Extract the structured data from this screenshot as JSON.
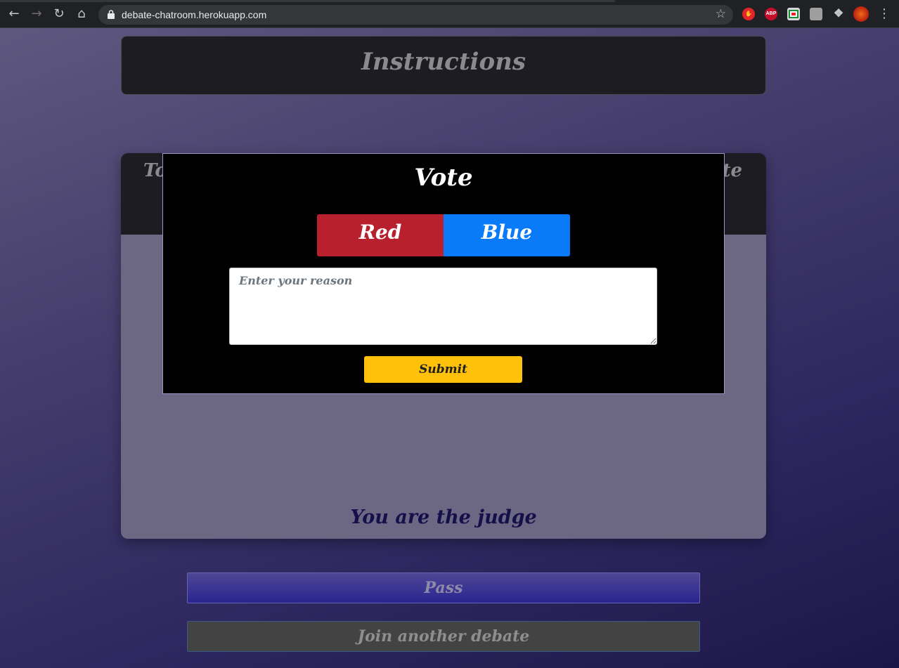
{
  "browser": {
    "url": "debate-chatroom.herokuapp.com",
    "extensions": [
      {
        "name": "hand-stop-extension-icon",
        "label": "",
        "color": "#e3242b"
      },
      {
        "name": "adblock-plus-icon",
        "label": "ABP",
        "color": "#c70d2c"
      },
      {
        "name": "pocket-extension-icon",
        "label": "",
        "color": "#d8d8d8"
      },
      {
        "name": "grey-extension-icon",
        "label": "",
        "color": "#9e9e9e"
      },
      {
        "name": "puzzle-extensions-icon",
        "label": "",
        "color": "#c4c7c5"
      },
      {
        "name": "profile-avatar-icon",
        "label": "",
        "color": "#c9391a"
      }
    ]
  },
  "page": {
    "instructions_title": "Instructions",
    "topic_left_fragment": "To",
    "topic_right_fragment": "te",
    "judge_text": "You are the judge",
    "pass_label": "Pass",
    "join_label": "Join another debate"
  },
  "modal": {
    "title": "Vote",
    "red_label": "Red",
    "blue_label": "Blue",
    "reason_placeholder": "Enter your reason",
    "submit_label": "Submit"
  },
  "colors": {
    "red": "#b8202e",
    "blue": "#0a7bf8",
    "submit": "#ffc10a",
    "judge_text": "#150f4a"
  }
}
